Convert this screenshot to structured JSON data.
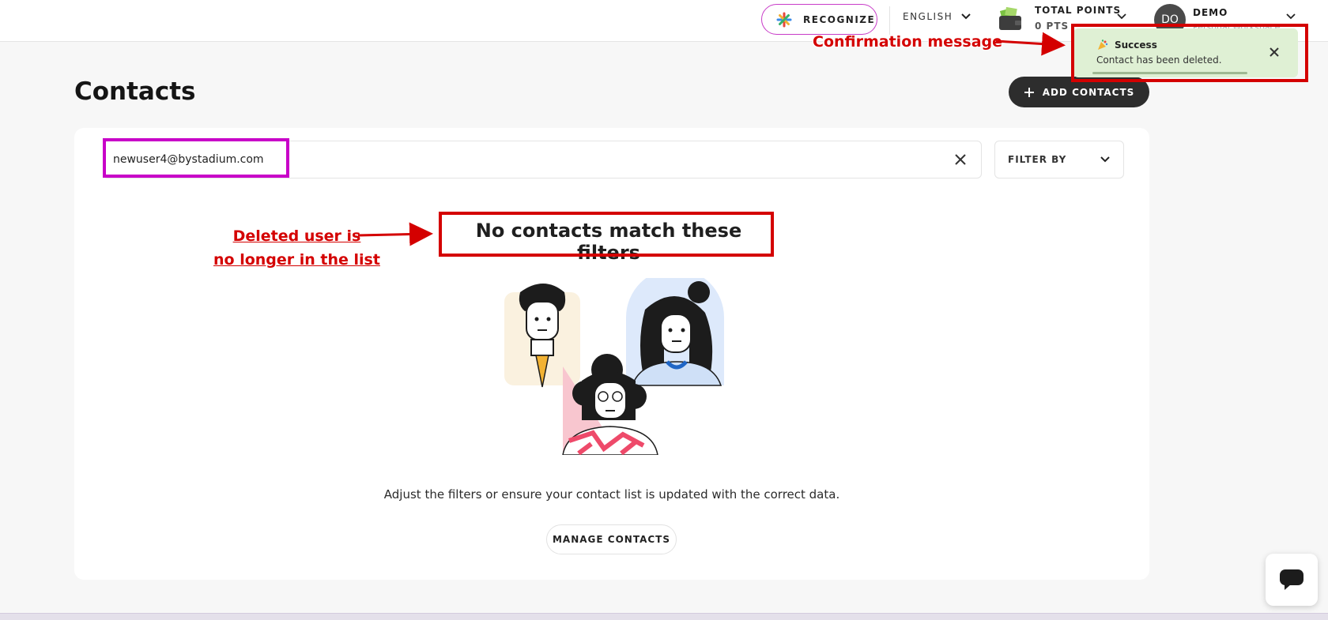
{
  "header": {
    "recognize_label": "RECOGNIZE",
    "language": "ENGLISH",
    "points_label": "TOTAL POINTS",
    "points_value": "0 PTS",
    "avatar_initials": "DO",
    "user_name": "DEMO",
    "workspace": "Personal Workspace"
  },
  "page": {
    "title": "Contacts",
    "add_contacts_label": "ADD CONTACTS"
  },
  "search": {
    "value": "newuser4@bystadium.com"
  },
  "filter": {
    "label": "FILTER BY"
  },
  "empty_state": {
    "title": "No contacts match these filters",
    "description": "Adjust the filters or ensure your contact list is updated with the correct data.",
    "manage_label": "MANAGE CONTACTS"
  },
  "toast": {
    "title": "Success",
    "message": "Contact has been deleted."
  },
  "annotations": {
    "confirmation": "Confirmation message",
    "deleted_line1": "Deleted user is",
    "deleted_line2": "no longer in the list"
  },
  "colors": {
    "annotation_red": "#d40000",
    "annotation_magenta": "#c800c8",
    "toast_bg": "#dff0d4",
    "primary_dark": "#2d2d2d"
  }
}
